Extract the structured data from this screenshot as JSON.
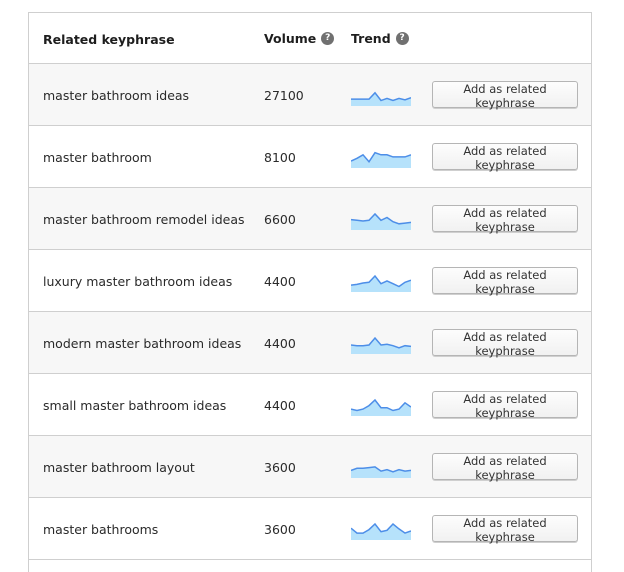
{
  "table": {
    "headers": {
      "keyphrase": "Related keyphrase",
      "volume": "Volume",
      "trend": "Trend",
      "help_glyph": "?"
    },
    "button_label": "Add as related keyphrase",
    "rows": [
      {
        "keyphrase": "master bathroom ideas",
        "volume": "27100",
        "trend": [
          0.35,
          0.35,
          0.35,
          0.35,
          0.8,
          0.25,
          0.4,
          0.25,
          0.4,
          0.3,
          0.45
        ]
      },
      {
        "keyphrase": "master bathroom",
        "volume": "8100",
        "trend": [
          0.35,
          0.55,
          0.8,
          0.3,
          0.95,
          0.8,
          0.8,
          0.65,
          0.65,
          0.65,
          0.8
        ]
      },
      {
        "keyphrase": "master bathroom remodel ideas",
        "volume": "6600",
        "trend": [
          0.6,
          0.55,
          0.5,
          0.55,
          1.0,
          0.55,
          0.75,
          0.45,
          0.3,
          0.35,
          0.4
        ]
      },
      {
        "keyphrase": "luxury master bathroom ideas",
        "volume": "4400",
        "trend": [
          0.35,
          0.4,
          0.5,
          0.55,
          1.0,
          0.45,
          0.65,
          0.45,
          0.25,
          0.55,
          0.7
        ]
      },
      {
        "keyphrase": "modern master bathroom ideas",
        "volume": "4400",
        "trend": [
          0.5,
          0.45,
          0.45,
          0.5,
          1.0,
          0.5,
          0.55,
          0.45,
          0.3,
          0.45,
          0.4
        ]
      },
      {
        "keyphrase": "small master bathroom ideas",
        "volume": "4400",
        "trend": [
          0.35,
          0.25,
          0.35,
          0.6,
          1.0,
          0.45,
          0.45,
          0.25,
          0.35,
          0.8,
          0.5
        ]
      },
      {
        "keyphrase": "master bathroom layout",
        "volume": "3600",
        "trend": [
          0.4,
          0.55,
          0.55,
          0.6,
          0.65,
          0.35,
          0.45,
          0.3,
          0.45,
          0.35,
          0.4
        ]
      },
      {
        "keyphrase": "master bathrooms",
        "volume": "3600",
        "trend": [
          0.7,
          0.35,
          0.35,
          0.6,
          1.0,
          0.45,
          0.55,
          1.0,
          0.65,
          0.35,
          0.5
        ]
      }
    ]
  },
  "colors": {
    "trend_stroke": "#4d8ee8",
    "trend_fill": "#b6e2fb"
  }
}
